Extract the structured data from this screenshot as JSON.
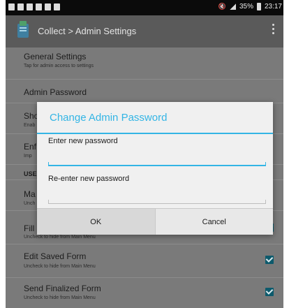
{
  "status_bar": {
    "battery": "35%",
    "time": "23:17",
    "left_icons": [
      "notification-icon",
      "gallery-icon",
      "gallery-icon",
      "notification-icon",
      "download-icon",
      "image-icon"
    ]
  },
  "action_bar": {
    "title": "Collect > Admin Settings"
  },
  "settings": {
    "general_title": "General Settings",
    "general_sub": "Tap for admin access to settings",
    "admin_password": "Admin Password",
    "item3_title": "Show",
    "item3_sub": "Enab",
    "item4_title": "Enf",
    "item4_sub": "Imp",
    "section_header": "USE",
    "item5_title": "Ma",
    "item5_sub": "Unch",
    "item6_title": "Fill",
    "item6_sub": "Uncheck to hide from Main Menu",
    "edit_saved_title": "Edit Saved Form",
    "edit_saved_sub": "Uncheck to hide from Main Menu",
    "send_finalized_title": "Send Finalized Form",
    "send_finalized_sub": "Uncheck to hide from Main Menu"
  },
  "dialog": {
    "title": "Change Admin Password",
    "label_new": "Enter new password",
    "label_reenter": "Re-enter new password",
    "value_new": "",
    "value_reenter": "",
    "ok_label": "OK",
    "cancel_label": "Cancel"
  },
  "colors": {
    "accent": "#33b5e5",
    "checkbox": "#0d5a6c",
    "dim_background": "#7a7a7a"
  }
}
